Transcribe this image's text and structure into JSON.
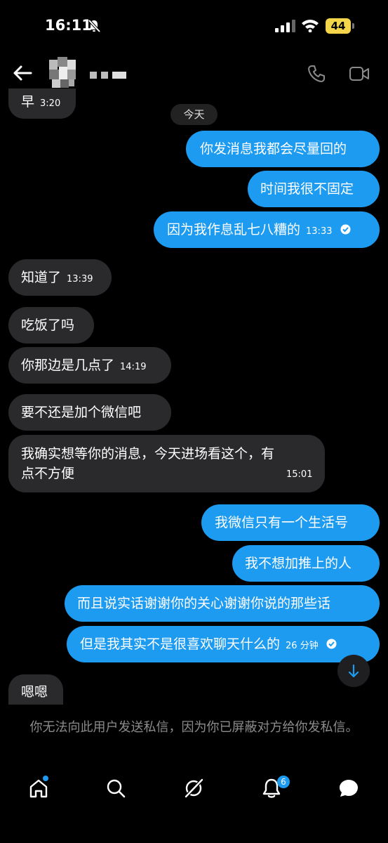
{
  "status_bar": {
    "time": "16:11",
    "battery": "44"
  },
  "header": {
    "contact_name": "▪▪▪▬"
  },
  "date_divider": "今天",
  "messages": [
    {
      "dir": "in",
      "text": "早",
      "time": "3:20"
    },
    {
      "dir": "out",
      "text": "你发消息我都会尽量回的"
    },
    {
      "dir": "out",
      "text": "时间我很不固定"
    },
    {
      "dir": "out",
      "text": "因为我作息乱七八糟的",
      "time": "13:33",
      "read": true
    },
    {
      "dir": "in",
      "text": "知道了",
      "time": "13:39"
    },
    {
      "dir": "in",
      "text": "吃饭了吗"
    },
    {
      "dir": "in",
      "text": "你那边是几点了",
      "time": "14:19"
    },
    {
      "dir": "in",
      "text": "要不还是加个微信吧"
    },
    {
      "dir": "in",
      "text_line1": "我确实想等你的消息，今天进场看这个，有",
      "text_line2": "点不方便",
      "time": "15:01"
    },
    {
      "dir": "out",
      "text": "我微信只有一个生活号"
    },
    {
      "dir": "out",
      "text": "我不想加推上的人"
    },
    {
      "dir": "out",
      "text": "而且说实话谢谢你的关心谢谢你说的那些话"
    },
    {
      "dir": "out",
      "text": "但是我其实不是很喜欢聊天什么的",
      "time": "26 分钟",
      "read": true
    },
    {
      "dir": "in",
      "text": "嗯嗯"
    }
  ],
  "blocked_notice": "你无法向此用户发送私信，因为你已屏蔽对方给你发私信。",
  "tabbar": {
    "notifications_count": "6"
  },
  "colors": {
    "accent": "#1d9bf0",
    "incoming_bubble": "#2a2a2d",
    "background": "#000000"
  },
  "icons": [
    "back-arrow-icon",
    "phone-icon",
    "video-camera-icon",
    "home-icon",
    "search-icon",
    "grok-icon",
    "bell-icon",
    "messages-icon",
    "arrow-down-icon",
    "read-check-icon"
  ]
}
